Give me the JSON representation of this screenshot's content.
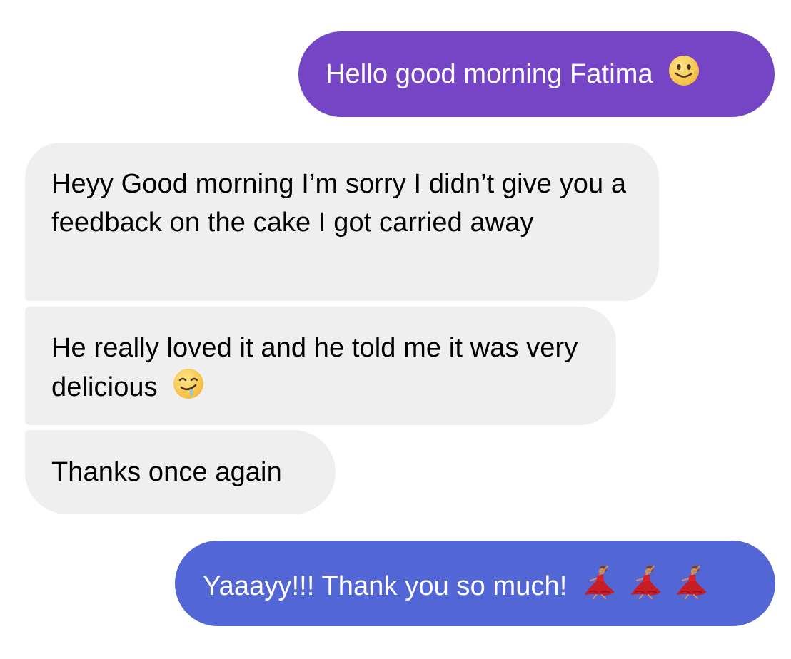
{
  "messages": [
    {
      "direction": "outgoing",
      "text": "Hello good morning Fatima",
      "emoji": "slightly-smiling-face",
      "color": "#7645c6"
    },
    {
      "direction": "incoming",
      "text": "Heyy Good morning I’m sorry I didn’t give you a feedback on the cake I got carried away",
      "color": "#efefef"
    },
    {
      "direction": "incoming",
      "text": "He really loved it and he told me it was very delicious",
      "emoji": "drooling-face",
      "color": "#efefef"
    },
    {
      "direction": "incoming",
      "text": "Thanks once again",
      "color": "#efefef"
    },
    {
      "direction": "outgoing",
      "text": "Yaaayy!!! Thank you so much!",
      "emoji": "woman-dancing",
      "emoji_count": 3,
      "color": "#5366d5"
    }
  ]
}
